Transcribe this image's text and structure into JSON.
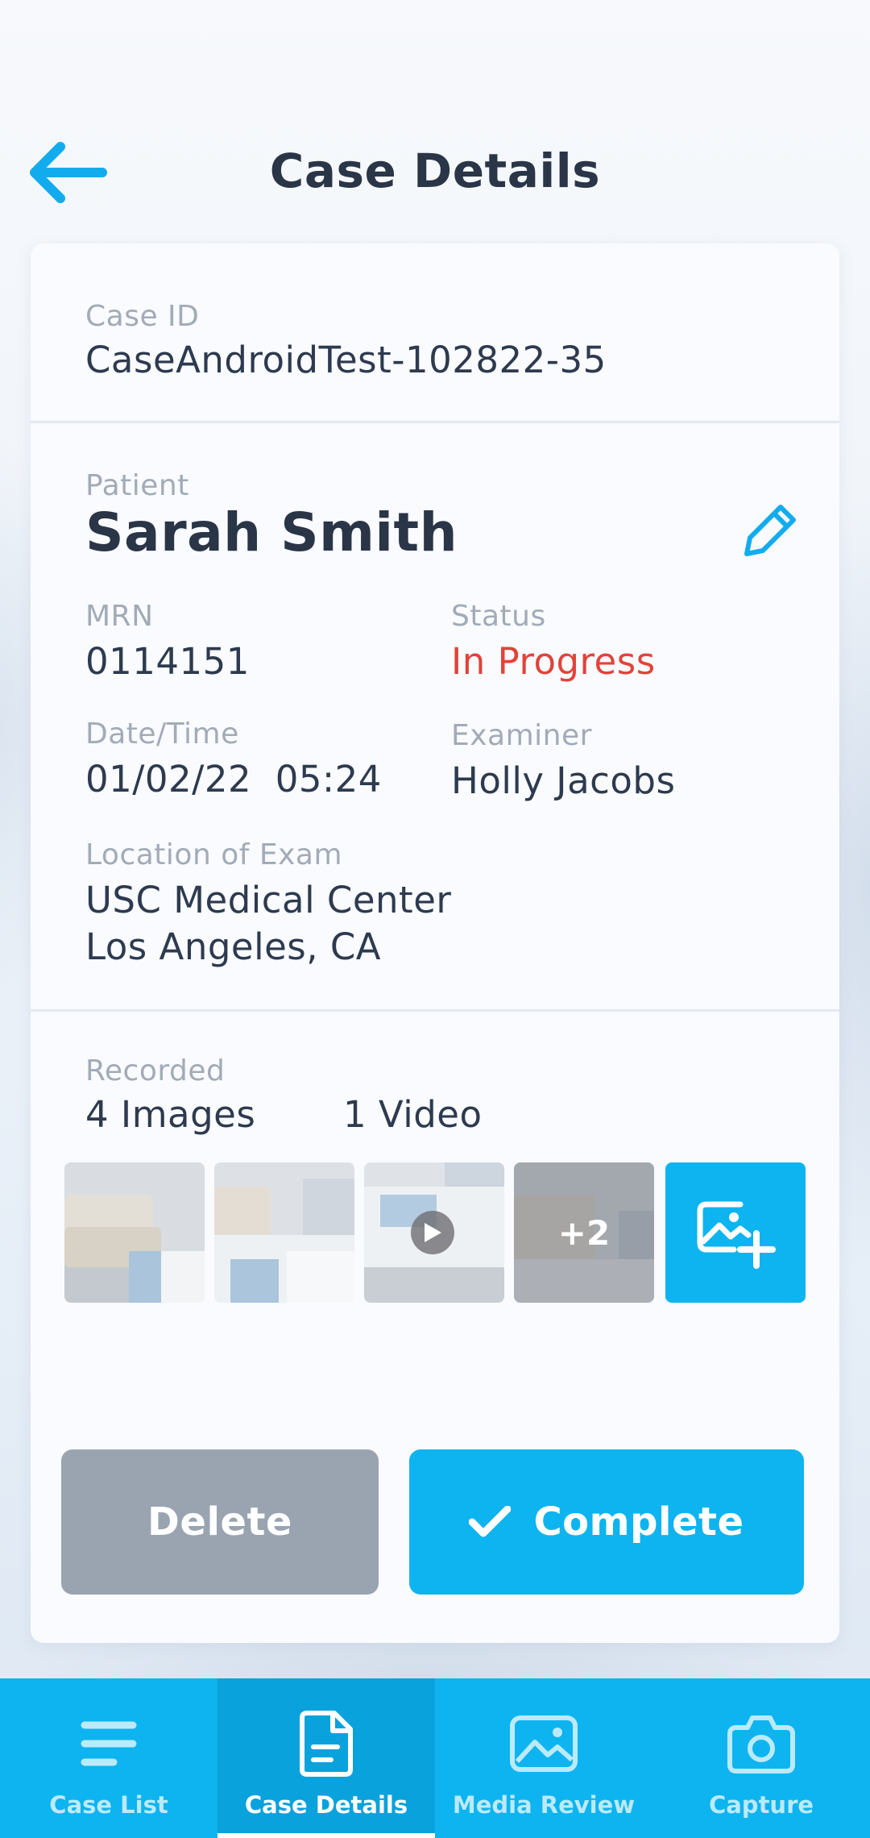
{
  "header": {
    "title": "Case Details",
    "back_icon": "arrow-left-icon"
  },
  "case": {
    "id_label": "Case ID",
    "id_value": "CaseAndroidTest-102822-35"
  },
  "patient": {
    "label": "Patient",
    "name": "Sarah Smith",
    "edit_icon": "pencil-icon",
    "mrn_label": "MRN",
    "mrn_value": "0114151",
    "status_label": "Status",
    "status_value": "In Progress",
    "datetime_label": "Date/Time",
    "datetime_value": "01/02/22  05:24",
    "examiner_label": "Examiner",
    "examiner_value": "Holly Jacobs",
    "location_label": "Location of Exam",
    "location_line1": "USC Medical Center",
    "location_line2": "Los Angeles, CA"
  },
  "recorded": {
    "label": "Recorded",
    "images_count": "4 Images",
    "videos_count": "1 Video",
    "more_overlay": "+2",
    "add_icon": "add-image-icon"
  },
  "actions": {
    "delete_label": "Delete",
    "complete_label": "Complete"
  },
  "nav": {
    "items": [
      {
        "label": "Case List",
        "icon": "list-icon"
      },
      {
        "label": "Case Details",
        "icon": "document-icon",
        "active": true
      },
      {
        "label": "Media Review",
        "icon": "image-icon"
      },
      {
        "label": "Capture",
        "icon": "camera-icon"
      }
    ]
  },
  "colors": {
    "accent": "#0db4ef",
    "status": "#e0443a",
    "delete": "#9aa4b1",
    "title": "#2a3547"
  }
}
